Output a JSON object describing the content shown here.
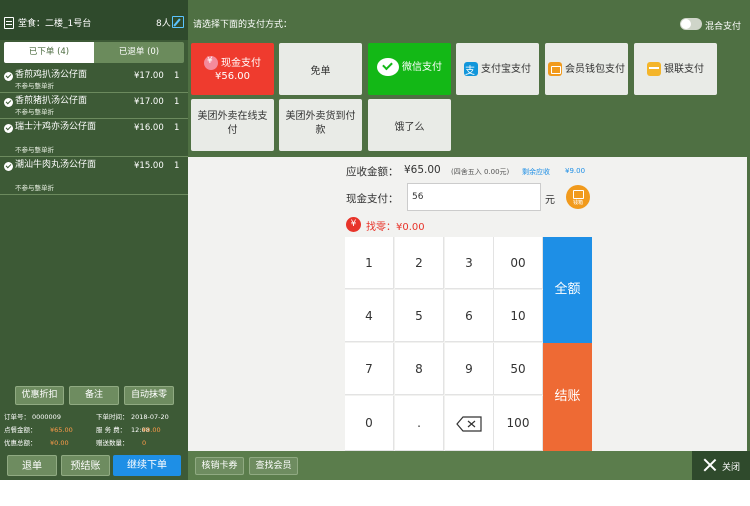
{
  "left": {
    "title": "堂食：二楼_1号台",
    "guest_count": "8人",
    "tabs": {
      "ordered": "已下单 (4)",
      "returned": "已退单 (0)"
    },
    "items": [
      {
        "name": "香煎鸡扒汤公仔面",
        "sub": "不参与整单折",
        "price": "¥17.00",
        "qty": "1"
      },
      {
        "name": "香煎猪扒汤公仔面",
        "sub": "不参与整单折",
        "price": "¥17.00",
        "qty": "1"
      },
      {
        "name": "瑞士汁鸡亦汤公仔面",
        "sub": "不参与整单折",
        "price": "¥16.00",
        "qty": "1"
      },
      {
        "name": "潮汕牛肉丸汤公仔面",
        "sub": "不参与整单折",
        "price": "¥15.00",
        "qty": "1"
      }
    ],
    "actions": {
      "discount": "优惠折扣",
      "note": "备注",
      "auto_round": "自动抹零"
    },
    "info": {
      "order_no_label": "订单号：",
      "order_no": "0000009",
      "time_label": "下单时间：",
      "time": "2018-07-20 12:08",
      "meal_amount_label": "点餐金额：",
      "meal_amount": "¥65.00",
      "service_fee_label": "服 务 费：",
      "service_fee": "¥0.00",
      "discount_total_label": "优惠总额：",
      "discount_total": "¥0.00",
      "gift_qty_label": "赠送数量：",
      "gift_qty": "0"
    },
    "bottom": {
      "return": "退单",
      "pre_settle": "预结账",
      "continue": "继续下单"
    }
  },
  "header": {
    "prompt": "请选择下面的支付方式：",
    "mixed_label": "混合支付"
  },
  "payments": {
    "cash": "现金支付",
    "cash_amount": "¥56.00",
    "free": "免单",
    "wechat": "微信支付",
    "alipay": "支付宝支付",
    "wallet": "会员钱包支付",
    "unionpay": "银联支付",
    "meituan_online": "美团外卖在线支付",
    "meituan_cod": "美团外卖货到付款",
    "eleme": "饿了么"
  },
  "amounts": {
    "due_label": "应收金额：",
    "due": "¥65.00",
    "rounding": "(四舍五入 0.00元)",
    "remaining_label": "剩余应收",
    "remaining": "¥9.00",
    "cash_label": "现金支付：",
    "cash_value": "56",
    "unit": "元",
    "coin_label": "钱箱",
    "change_icon": "¥",
    "change": "找零：¥0.00"
  },
  "keypad": {
    "keys": [
      "1",
      "2",
      "3",
      "00",
      "4",
      "5",
      "6",
      "10",
      "7",
      "8",
      "9",
      "50",
      "0",
      ".",
      "",
      "100"
    ],
    "full": "全额",
    "settle": "结账"
  },
  "footer": {
    "verify_card": "核销卡券",
    "find_member": "查找会员",
    "close": "关闭"
  }
}
